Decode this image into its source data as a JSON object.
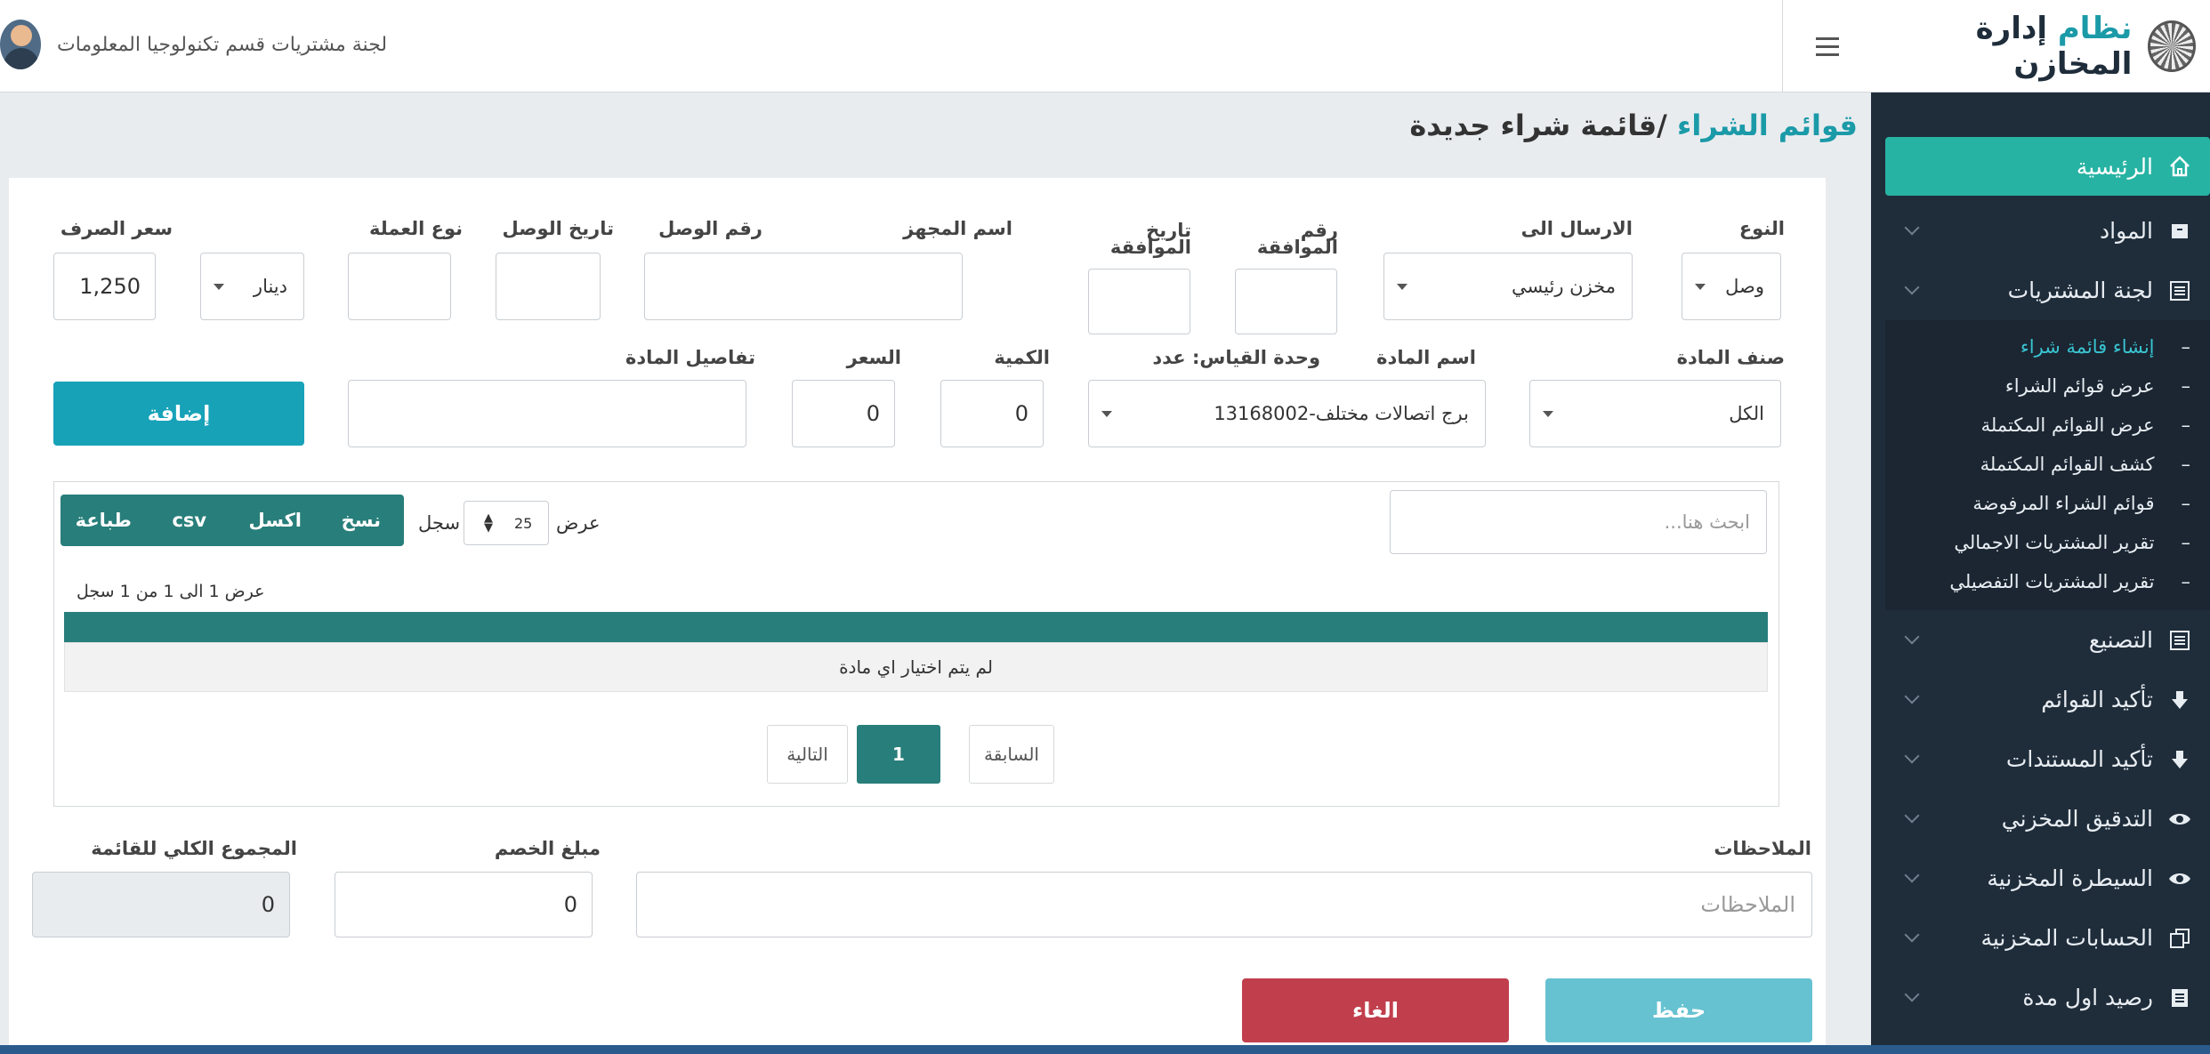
{
  "app": {
    "title_part1": "نظام",
    "title_part2": "إدارة المخازن"
  },
  "topbar": {
    "user_name": "لجنة مشتريات قسم تكنولوجيا المعلومات"
  },
  "sidebar": {
    "home": "الرئيسية",
    "items": [
      {
        "label": "المواد"
      },
      {
        "label": "لجنة المشتريات"
      }
    ],
    "submenu": [
      {
        "label": "إنشاء قائمة شراء"
      },
      {
        "label": "عرض قوائم الشراء"
      },
      {
        "label": "عرض القوائم المكتملة"
      },
      {
        "label": "كشف القوائم المكتملة"
      },
      {
        "label": "قوائم الشراء المرفوضة"
      },
      {
        "label": "تقرير المشتريات الاجمالي"
      },
      {
        "label": "تقرير المشتريات التفصيلي"
      }
    ],
    "items_after": [
      {
        "label": "التصنيع"
      },
      {
        "label": "تأكيد القوائم"
      },
      {
        "label": "تأكيد المستندات"
      },
      {
        "label": "التدقيق المخزني"
      },
      {
        "label": "السيطرة المخزنية"
      },
      {
        "label": "الحسابات المخزنية"
      },
      {
        "label": "رصيد اول مدة"
      }
    ]
  },
  "breadcrumb": {
    "parent": "قوائم الشراء",
    "separator": " /",
    "current": "قائمة شراء جديدة"
  },
  "form": {
    "type": {
      "label": "النوع",
      "value": "وصل"
    },
    "send_to": {
      "label": "الارسال الى",
      "value": "مخزن رئيسي"
    },
    "approval_no": {
      "label_l1": "رقم",
      "label_l2": "الموافقة",
      "value": ""
    },
    "approval_date": {
      "label_l1": "تاريخ",
      "label_l2": "الموافقة",
      "value": ""
    },
    "device_name": {
      "label": "اسم المجهز",
      "value": ""
    },
    "receipt_no": {
      "label": "رقم الوصل",
      "value": ""
    },
    "receipt_date": {
      "label": "تاريخ الوصل",
      "value": ""
    },
    "currency": {
      "label": "نوع العملة",
      "value": "دينار"
    },
    "exchange_rate": {
      "label": "سعر الصرف",
      "value": "1,250"
    },
    "item_class": {
      "label": "صنف المادة",
      "value": "الكل"
    },
    "item_name": {
      "label": "اسم المادة",
      "value": "برج اتصالات مختلف-13168002"
    },
    "unit": {
      "label": "وحدة القياس: عدد"
    },
    "quantity": {
      "label": "الكمية",
      "value": "0"
    },
    "price": {
      "label": "السعر",
      "value": "0"
    },
    "item_details": {
      "label": "تفاصيل المادة",
      "value": ""
    },
    "add_button": "إضافة"
  },
  "table": {
    "search_placeholder": "ابحث هنا...",
    "show_label": "عرض",
    "page_length": "25",
    "records_label": "سجل",
    "export_buttons": [
      "نسخ",
      "اكسل",
      "csv",
      "طباعة"
    ],
    "info": "عرض 1 الى 1 من 1 سجل",
    "empty_message": "لم يتم اختيار اي مادة",
    "pager": {
      "prev": "السابقة",
      "current": "1",
      "next": "التالية"
    }
  },
  "footer": {
    "notes": {
      "label": "الملاحظات",
      "placeholder": "الملاحظات"
    },
    "discount": {
      "label": "مبلغ الخصم",
      "value": "0"
    },
    "total": {
      "label": "المجموع الكلي للقائمة",
      "value": "0"
    },
    "save_button": "حفظ",
    "cancel_button": "الغاء"
  },
  "colors": {
    "accent": "#27b3a3",
    "teal_dark": "#287e7a",
    "sidebar_bg": "#1f2d3b",
    "danger": "#c13f4d",
    "info": "#17a2b8"
  }
}
